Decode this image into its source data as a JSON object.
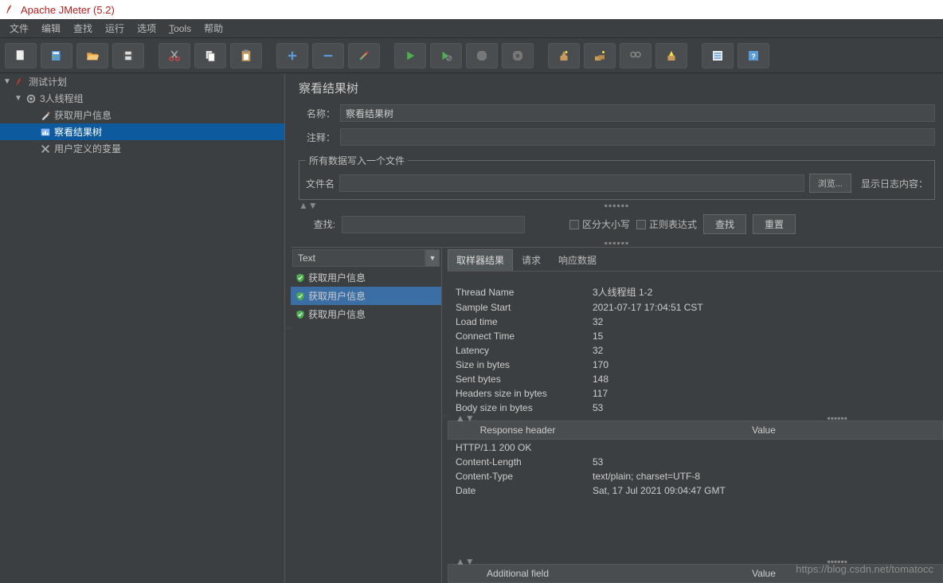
{
  "window": {
    "title": "Apache JMeter (5.2)"
  },
  "menu": {
    "file": "文件",
    "edit": "编辑",
    "search": "查找",
    "run": "运行",
    "options": "选项",
    "tools": "Tools",
    "help": "帮助"
  },
  "tree": {
    "root": "测试计划",
    "threadgroup": "3人线程组",
    "sampler": "获取用户信息",
    "listener": "察看结果树",
    "uservars": "用户定义的变量"
  },
  "panel": {
    "title": "察看结果树",
    "name_label": "名称：",
    "name_value": "察看结果树",
    "comment_label": "注释：",
    "comment_value": "",
    "filewrite_legend": "所有数据写入一个文件",
    "filename_label": "文件名",
    "filename_value": "",
    "browse_btn": "浏览...",
    "showlog_label": "显示日志内容：",
    "search_label": "查找:",
    "search_value": "",
    "case_label": "区分大小写",
    "regex_label": "正则表达式",
    "search_btn": "查找",
    "reset_btn": "重置",
    "renderer": "Text"
  },
  "samples": {
    "items": [
      "获取用户信息",
      "获取用户信息",
      "获取用户信息"
    ]
  },
  "tabs": {
    "sampler": "取样器结果",
    "request": "请求",
    "response": "响应数据"
  },
  "details": {
    "rows": [
      [
        "Thread Name",
        "3人线程组 1-2"
      ],
      [
        "Sample Start",
        "2021-07-17 17:04:51 CST"
      ],
      [
        "Load time",
        "32"
      ],
      [
        "Connect Time",
        "15"
      ],
      [
        "Latency",
        "32"
      ],
      [
        "Size in bytes",
        "170"
      ],
      [
        "Sent bytes",
        "148"
      ],
      [
        "Headers size in bytes",
        "117"
      ],
      [
        "Body size in bytes",
        "53"
      ]
    ],
    "resp_header_col1": "Response header",
    "resp_header_col2": "Value",
    "resp_rows": [
      [
        "HTTP/1.1 200 OK",
        ""
      ],
      [
        "Content-Length",
        "53"
      ],
      [
        "Content-Type",
        "text/plain; charset=UTF-8"
      ],
      [
        "Date",
        "Sat, 17 Jul 2021 09:04:47 GMT"
      ]
    ],
    "add_field_col1": "Additional field",
    "add_field_col2": "Value"
  },
  "watermark": "https://blog.csdn.net/tomatocc"
}
